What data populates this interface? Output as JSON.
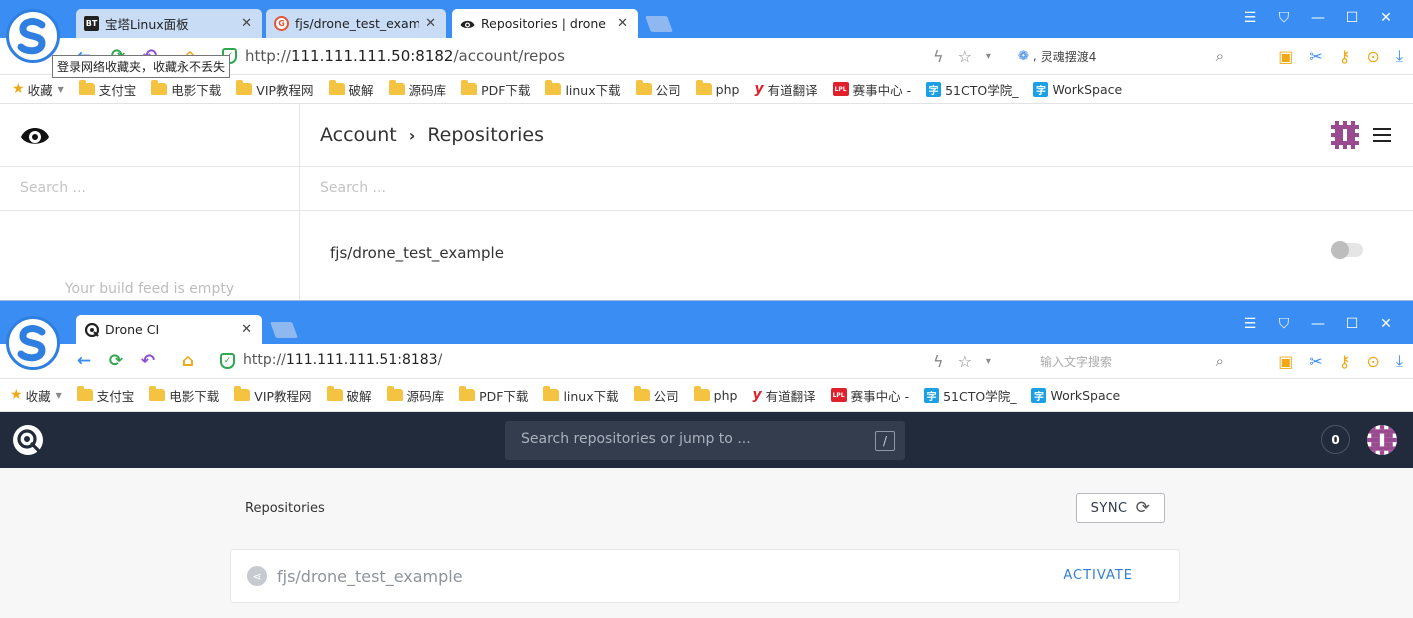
{
  "window1": {
    "tabs": [
      {
        "label": "宝塔Linux面板",
        "favicon": "BT",
        "active": false
      },
      {
        "label": "fjs/drone_test_example",
        "favicon": "git-icon",
        "active": false
      },
      {
        "label": "Repositories | drone",
        "favicon": "drone-eye-icon",
        "active": true
      }
    ],
    "url": {
      "scheme": "http://",
      "host": "111.111.111.50:8182",
      "path": "/account/repos"
    },
    "search_text": "灵魂摆渡4",
    "tooltip": "登录网络收藏夹，收藏永不丢失",
    "app": {
      "sidebar_search_placeholder": "Search ...",
      "breadcrumb": [
        "Account",
        "Repositories"
      ],
      "main_search_placeholder": "Search ...",
      "repo_name": "fjs/drone_test_example",
      "empty_feed": "Your build feed is empty"
    }
  },
  "window2": {
    "tabs": [
      {
        "label": "Drone CI",
        "favicon": "drone-ci-icon",
        "active": true
      }
    ],
    "url": {
      "scheme": "http://",
      "host": "111.111.111.51:8183",
      "path": "/"
    },
    "search_placeholder": "输入文字搜索",
    "app": {
      "search_placeholder": "Search repositories or jump to ...",
      "search_shortcut": "/",
      "notification_count": "0",
      "section_title": "Repositories",
      "sync_label": "SYNC",
      "repo_name": "fjs/drone_test_example",
      "activate_label": "ACTIVATE"
    }
  },
  "bookmarks": [
    {
      "label": "收藏",
      "icon": "star-icon"
    },
    {
      "label": "支付宝",
      "icon": "folder-icon"
    },
    {
      "label": "电影下载",
      "icon": "folder-icon"
    },
    {
      "label": "VIP教程网",
      "icon": "folder-icon"
    },
    {
      "label": "破解",
      "icon": "folder-icon"
    },
    {
      "label": "源码库",
      "icon": "folder-icon"
    },
    {
      "label": "PDF下载",
      "icon": "folder-icon"
    },
    {
      "label": "linux下载",
      "icon": "folder-icon"
    },
    {
      "label": "公司",
      "icon": "folder-icon"
    },
    {
      "label": "php",
      "icon": "folder-icon"
    },
    {
      "label": "有道翻译",
      "icon": "youdao-icon"
    },
    {
      "label": "赛事中心 -",
      "icon": "lpl-icon"
    },
    {
      "label": "51CTO学院_",
      "icon": "51cto-icon"
    },
    {
      "label": "WorkSpace",
      "icon": "51cto-icon"
    }
  ],
  "colors": {
    "titlebar": "#3a8ef3",
    "drone_nav": "#212b3b",
    "activate": "#2f7ed8"
  }
}
